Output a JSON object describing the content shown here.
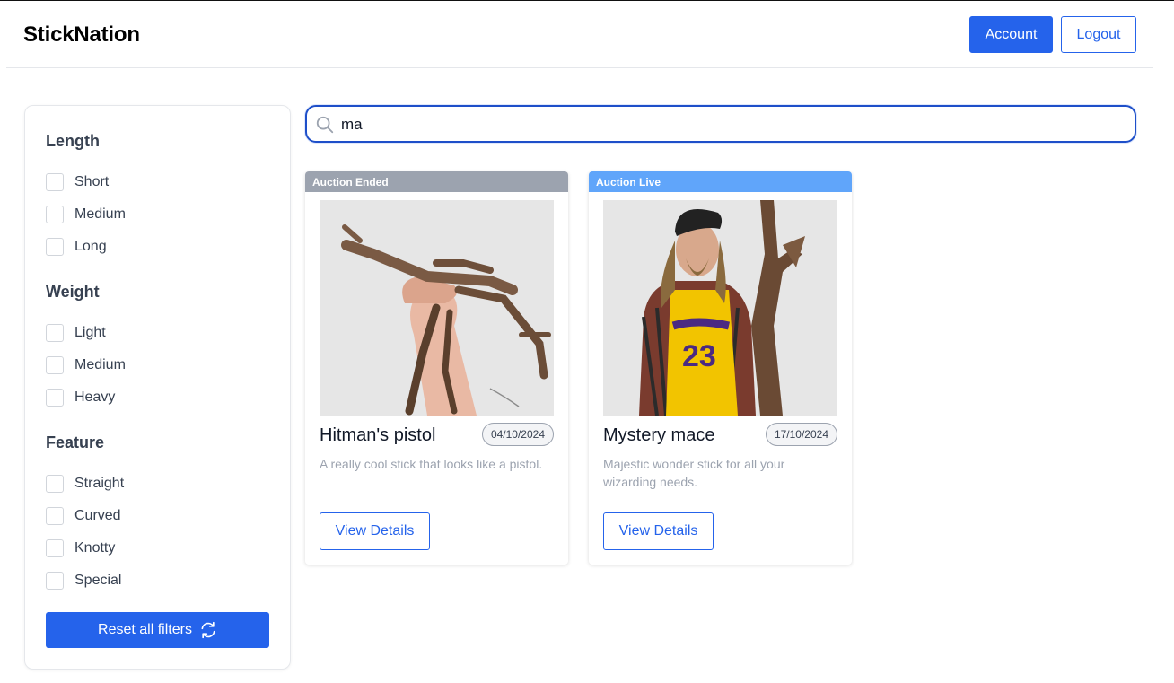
{
  "header": {
    "brand": "StickNation",
    "account_label": "Account",
    "logout_label": "Logout"
  },
  "filters": {
    "groups": [
      {
        "title": "Length",
        "options": [
          "Short",
          "Medium",
          "Long"
        ]
      },
      {
        "title": "Weight",
        "options": [
          "Light",
          "Medium",
          "Heavy"
        ]
      },
      {
        "title": "Feature",
        "options": [
          "Straight",
          "Curved",
          "Knotty",
          "Special"
        ]
      }
    ],
    "reset_label": "Reset all filters",
    "reset_icon": "refresh-icon"
  },
  "search": {
    "value": "ma",
    "icon": "search-icon"
  },
  "listings": [
    {
      "status": "Auction Ended",
      "status_color": "#9ca3af",
      "title": "Hitman's pistol",
      "date": "04/10/2024",
      "description": "A really cool stick that looks like a pistol.",
      "button_label": "View Details"
    },
    {
      "status": "Auction Live",
      "status_color": "#60a5fa",
      "title": "Mystery mace",
      "date": "17/10/2024",
      "description": "Majestic wonder stick for all your wizarding needs.",
      "button_label": "View Details"
    }
  ],
  "colors": {
    "primary": "#2563eb",
    "text": "#374151",
    "muted": "#9ca3af"
  }
}
